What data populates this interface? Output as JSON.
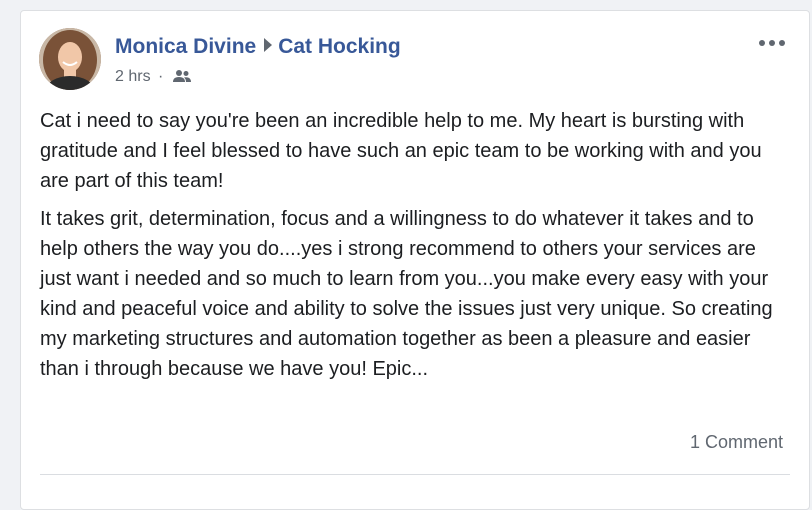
{
  "post": {
    "author": "Monica Divine",
    "recipient": "Cat Hocking",
    "time": "2 hrs",
    "separator": "·",
    "audience_icon": "friends-icon",
    "more_icon": "more-options-icon",
    "paragraphs": [
      "Cat i need to say you're been an incredible help to me. My heart is bursting with gratitude and I feel blessed to have such an epic team to be working with and you are part of this team!",
      "It takes grit, determination, focus and a willingness to do whatever it takes and to help others the way you do....yes i strong recommend to others your services are just want i needed and so much to learn from you...you make every easy with your kind and peaceful voice and ability to solve the issues just very unique. So creating my marketing structures and automation together as been a pleasure and easier than i through because we have you! Epic..."
    ],
    "comments_count": "1 Comment"
  },
  "colors": {
    "link": "#385898",
    "meta": "#606770",
    "text": "#1c1e21"
  }
}
